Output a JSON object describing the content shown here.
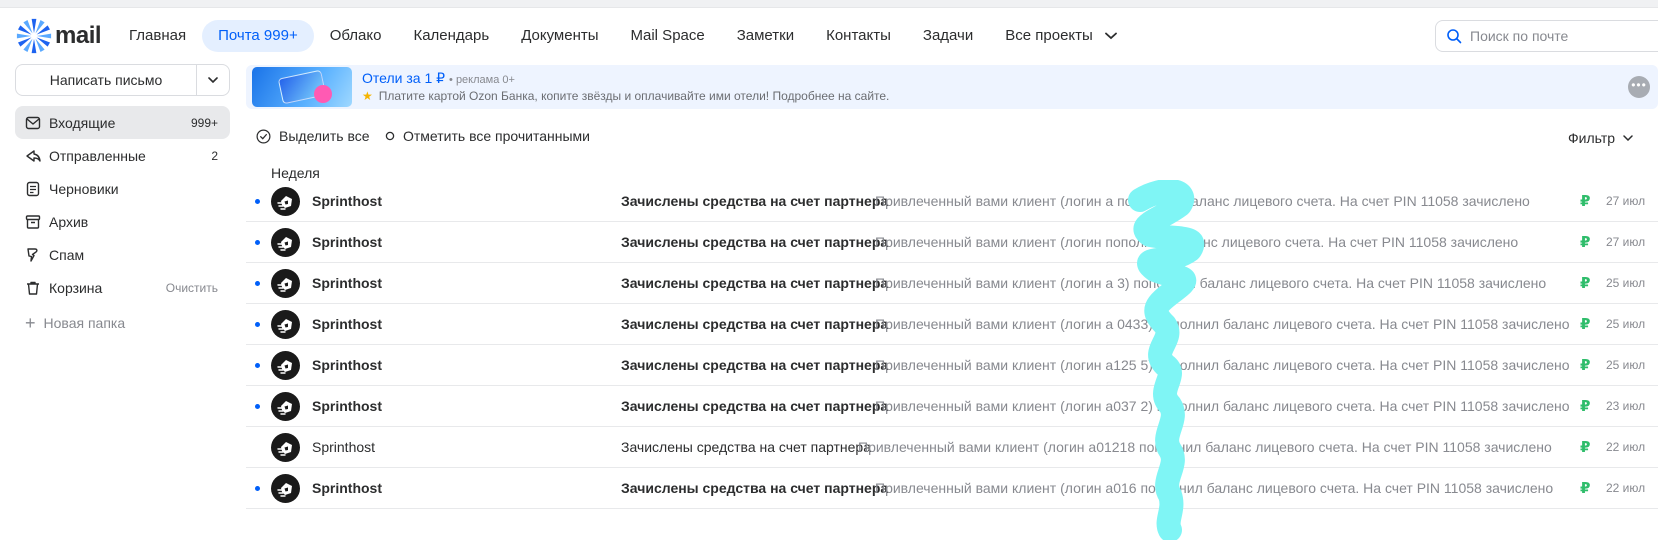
{
  "header": {
    "logo_text": "mail",
    "nav": [
      {
        "label": "Главная"
      },
      {
        "label": "Почта 999+",
        "active": true
      },
      {
        "label": "Облако"
      },
      {
        "label": "Календарь"
      },
      {
        "label": "Документы"
      },
      {
        "label": "Mail Space"
      },
      {
        "label": "Заметки"
      },
      {
        "label": "Контакты"
      },
      {
        "label": "Задачи"
      },
      {
        "label": "Все проекты"
      }
    ],
    "search_placeholder": "Поиск по почте"
  },
  "sidebar": {
    "compose_label": "Написать письмо",
    "folders": [
      {
        "label": "Входящие",
        "count": "999+",
        "icon": "inbox-icon",
        "active": true
      },
      {
        "label": "Отправленные",
        "count": "2",
        "icon": "sent-icon"
      },
      {
        "label": "Черновики",
        "count": "",
        "icon": "drafts-icon"
      },
      {
        "label": "Архив",
        "count": "",
        "icon": "archive-icon"
      },
      {
        "label": "Спам",
        "count": "",
        "icon": "spam-icon"
      },
      {
        "label": "Корзина",
        "action": "Очистить",
        "icon": "trash-icon"
      }
    ],
    "new_folder_label": "Новая папка"
  },
  "ad": {
    "title": "Отели за 1 ₽",
    "meta": "• реклама 0+",
    "description": "Платите картой Ozon Банка, копите звёзды и оплачивайте ими отели! Подробнее на сайте."
  },
  "toolbar": {
    "select_all": "Выделить все",
    "mark_read": "Отметить все прочитанными",
    "filter": "Фильтр"
  },
  "group_label": "Неделя",
  "messages": [
    {
      "sender": "Sprinthost",
      "subject": "Зачислены средства на счет партнера",
      "snippet": "Привлеченный вами клиент (логин а  пополнил баланс лицевого счета. На счет PIN 11058 зачислено",
      "date": "27 июл",
      "unread": true
    },
    {
      "sender": "Sprinthost",
      "subject": "Зачислены средства на счет партнера",
      "snippet": "Привлеченный вами клиент (логин    пополнил баланс лицевого счета. На счет PIN 11058 зачислено",
      "date": "27 июл",
      "unread": true
    },
    {
      "sender": "Sprinthost",
      "subject": "Зачислены средства на счет партнера",
      "snippet": "Привлеченный вами клиент (логин а 3) пополнил баланс лицевого счета. На счет PIN 11058 зачислено",
      "date": "25 июл",
      "unread": true
    },
    {
      "sender": "Sprinthost",
      "subject": "Зачислены средства на счет партнера",
      "snippet": "Привлеченный вами клиент (логин а 0433) пополнил баланс лицевого счета. На счет PIN 11058 зачислено",
      "date": "25 июл",
      "unread": true
    },
    {
      "sender": "Sprinthost",
      "subject": "Зачислены средства на счет партнера",
      "snippet": "Привлеченный вами клиент (логин а125 5) пополнил баланс лицевого счета. На счет PIN 11058 зачислено",
      "date": "25 июл",
      "unread": true
    },
    {
      "sender": "Sprinthost",
      "subject": "Зачислены средства на счет партнера",
      "snippet": "Привлеченный вами клиент (логин а037 2) пополнил баланс лицевого счета. На счет PIN 11058 зачислено",
      "date": "23 июл",
      "unread": true
    },
    {
      "sender": "Sprinthost",
      "subject": "Зачислены средства на счет партнера",
      "snippet": "Привлеченный вами клиент (логин а01218  пополнил баланс лицевого счета. На счет PIN 11058 зачислено",
      "date": "22 июл",
      "unread": false
    },
    {
      "sender": "Sprinthost",
      "subject": "Зачислены средства на счет партнера",
      "snippet": "Привлеченный вами клиент (логин а016  пополнил баланс лицевого счета. На счет PIN 11058 зачислено",
      "date": "22 июл",
      "unread": true
    }
  ],
  "currency_symbol": "₽",
  "colors": {
    "accent": "#005ff9",
    "active_nav_bg": "#e4efff",
    "rub": "#2fbd6b",
    "scribble": "#7ff5f5"
  }
}
